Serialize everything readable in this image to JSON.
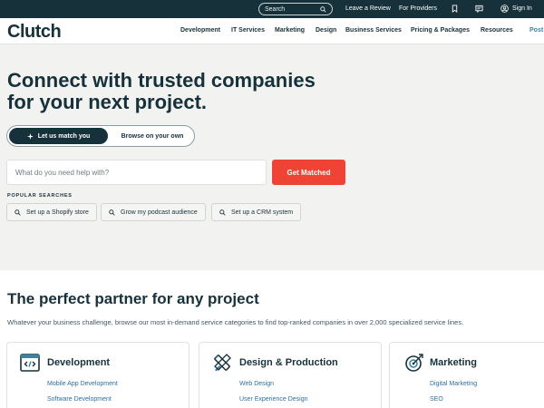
{
  "topbar": {
    "search_label": "Search",
    "leave_review": "Leave a Review",
    "for_providers": "For Providers",
    "sign_in": "Sign In"
  },
  "nav": {
    "logo": "Clutch",
    "items": [
      "Development",
      "IT Services",
      "Marketing",
      "Design",
      "Business Services",
      "Pricing & Packages",
      "Resources",
      "Post"
    ]
  },
  "hero": {
    "title_line1": "Connect with trusted companies",
    "title_line2": "for your next project.",
    "toggle_active": "Let us match you",
    "toggle_inactive": "Browse on your own",
    "search_placeholder": "What do you need help with?",
    "cta": "Get Matched",
    "popular_label": "POPULAR SEARCHES",
    "chips": [
      "Set up a Shopify store",
      "Grow my podcast audience",
      "Set up a CRM system"
    ]
  },
  "partner": {
    "title": "The perfect partner for any project",
    "subtitle": "Whatever your business challenge, browse our most in-demand service categories to find top-ranked companies in over 2,000 specialized service lines.",
    "cards": [
      {
        "title": "Development",
        "links": [
          "Mobile App Development",
          "Software Development"
        ]
      },
      {
        "title": "Design & Production",
        "links": [
          "Web Design",
          "User Experience Design"
        ]
      },
      {
        "title": "Marketing",
        "links": [
          "Digital Marketing",
          "SEO"
        ]
      }
    ]
  },
  "colors": {
    "navy": "#17313b",
    "accent_red": "#ef4335",
    "hero_bg": "#f2f2f0",
    "link_blue": "#2f6f9c",
    "icon_teal": "#3e839e"
  },
  "icons": {
    "search": "search-icon",
    "bookmark": "bookmark-icon",
    "message": "message-icon",
    "user": "user-icon",
    "sparkle": "sparkle-icon",
    "code": "code-icon",
    "design": "design-tools-icon",
    "target": "target-icon"
  }
}
